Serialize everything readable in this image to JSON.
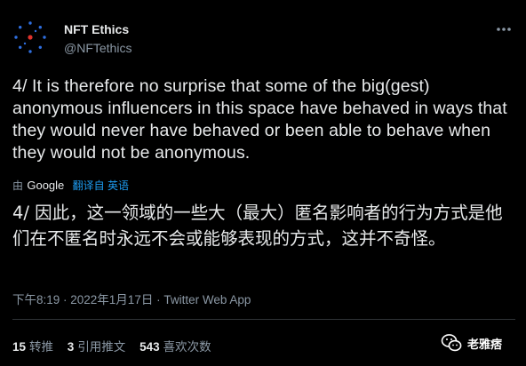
{
  "author": {
    "name": "NFT Ethics",
    "handle": "@NFTethics",
    "avatar_icon": "dotted-circle-logo",
    "avatar_colors": {
      "dots": "#2f6fe0",
      "center": "#e0322b"
    }
  },
  "tweet": {
    "text_en": "4/ It is therefore no surprise that some of the big(gest) anonymous influencers in this space have behaved in ways that they would never have behaved or been able to behave when they would not be anonymous.",
    "translation_prefix": "由",
    "translation_provider": "Google",
    "translation_label": "翻译自 英语",
    "text_zh": "4/ 因此，这一领域的一些大（最大）匿名影响者的行为方式是他们在不匿名时永远不会或能够表现的方式，这并不奇怪。",
    "timestamp": "下午8:19 · 2022年1月17日 · ",
    "source_app": "Twitter Web App"
  },
  "stats": [
    {
      "count": "15",
      "label": "转推"
    },
    {
      "count": "3",
      "label": "引用推文"
    },
    {
      "count": "543",
      "label": "喜欢次数"
    }
  ],
  "watermark": {
    "text": "老雅痞",
    "icon": "wechat-icon"
  },
  "colors": {
    "background": "#000000",
    "text_primary": "#e7e9ea",
    "text_secondary": "#8b98a5",
    "link": "#1d9bf0",
    "divider": "#2f3336"
  }
}
